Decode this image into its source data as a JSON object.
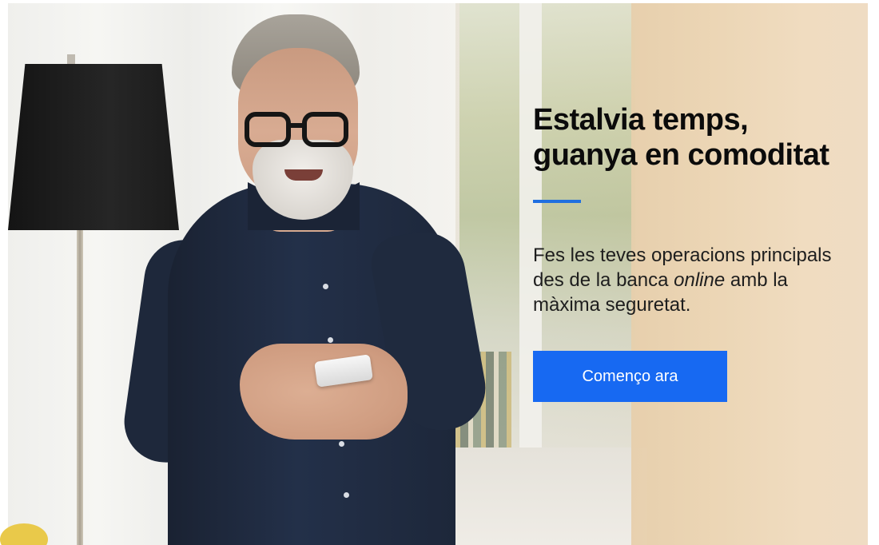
{
  "banner": {
    "headline_line1": "Estalvia temps,",
    "headline_line2": "guanya en comoditat",
    "body_part1": "Fes les teves operacions principals des de la banca ",
    "body_emphasis": "online",
    "body_part2": " amb la màxima seguretat.",
    "cta_label": "Començo ara"
  },
  "colors": {
    "accent": "#1f6fe0",
    "cta_background": "#1769f2",
    "cta_text": "#ffffff",
    "headline_text": "#0b0b0b"
  },
  "image": {
    "subject": "man-smiling-using-smartphone",
    "icon_names": [
      "floor-lamp-icon"
    ]
  }
}
